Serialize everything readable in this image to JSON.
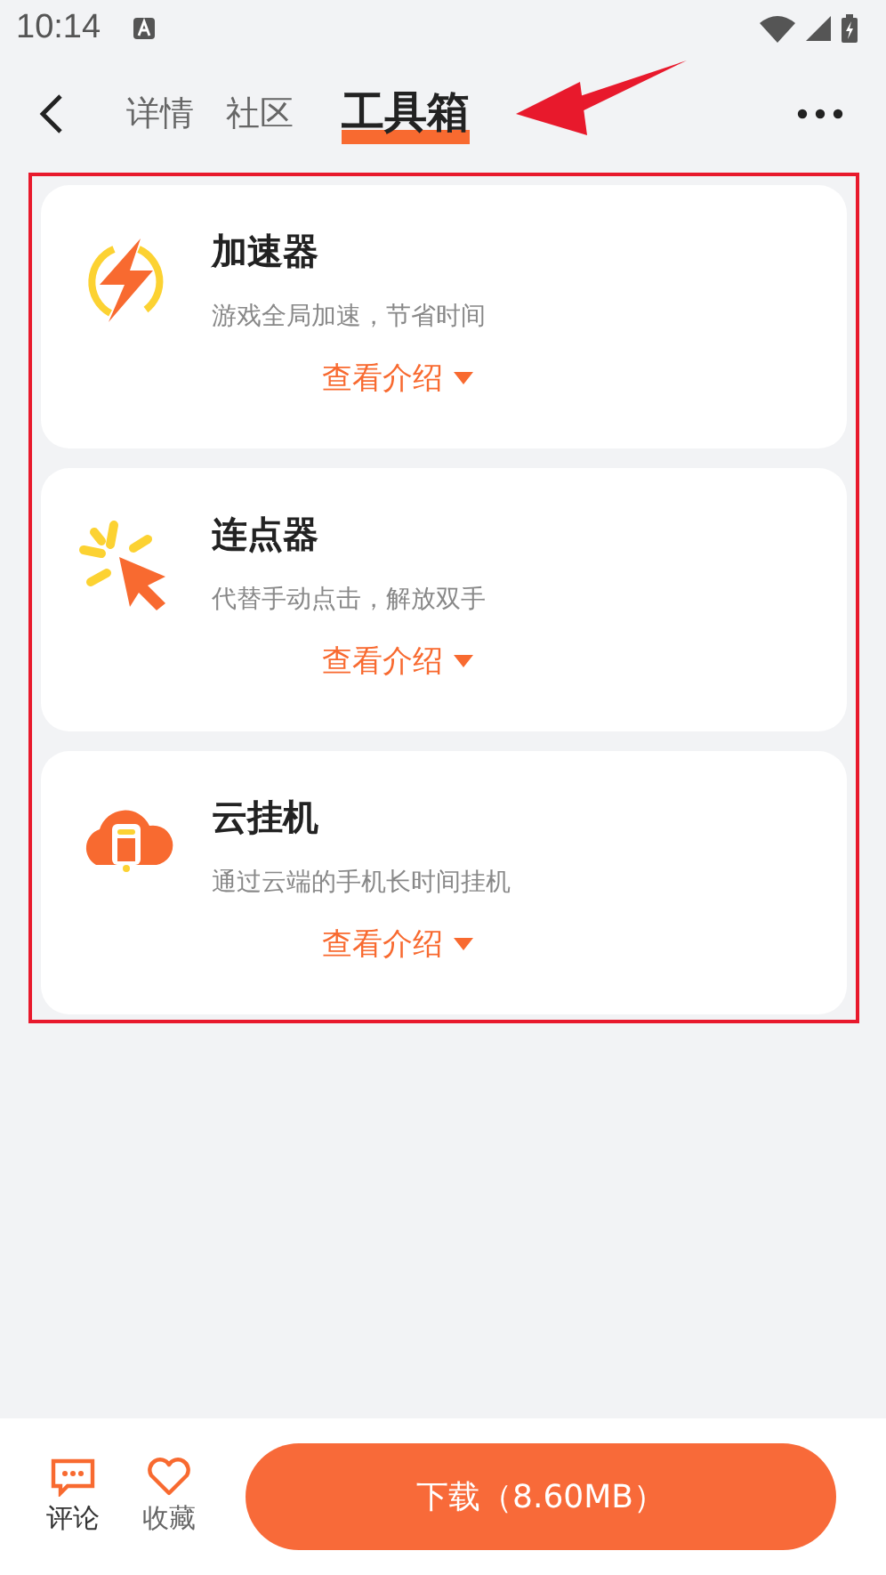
{
  "status_bar": {
    "time": "10:14"
  },
  "tabs": [
    {
      "label": "详情",
      "selected": false
    },
    {
      "label": "社区",
      "selected": false
    },
    {
      "label": "工具箱",
      "selected": true
    }
  ],
  "tools": [
    {
      "kind": "bolt",
      "name": "加速器",
      "description": "游戏全局加速，节省时间",
      "link": "查看介绍"
    },
    {
      "kind": "cursor",
      "name": "连点器",
      "description": "代替手动点击，解放双手",
      "link": "查看介绍"
    },
    {
      "kind": "cloud",
      "name": "云挂机",
      "description": "通过云端的手机长时间挂机",
      "link": "查看介绍"
    }
  ],
  "bottom_bar": {
    "comment": "评论",
    "favorite": "收藏",
    "download": "下载（8.60MB）"
  }
}
